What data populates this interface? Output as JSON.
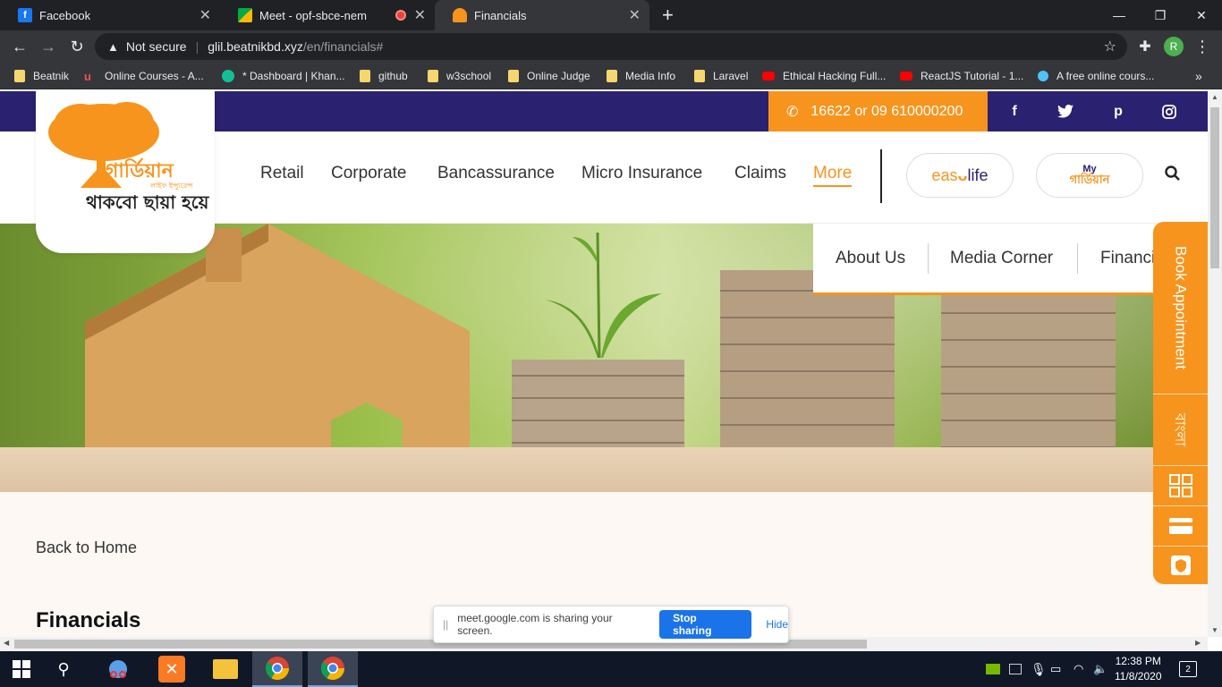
{
  "browser": {
    "tabs": [
      {
        "title": "Facebook",
        "favicon": "facebook-icon",
        "active": false
      },
      {
        "title": "Meet - opf-sbce-nem",
        "favicon": "google-meet-icon",
        "active": false,
        "recording": true
      },
      {
        "title": "Financials",
        "favicon": "guardian-umbrella-icon",
        "active": true
      }
    ],
    "new_tab_label": "+",
    "window_controls": {
      "minimize": "—",
      "restore": "❐",
      "close": "✕"
    },
    "security_label": "Not secure",
    "url_host": "glil.beatnikbd.xyz",
    "url_path": "/en/financials#",
    "profile_initial": "R",
    "bookmarks": [
      {
        "label": "Beatnik",
        "icon": "folder"
      },
      {
        "label": "Online Courses - A...",
        "icon": "udemy-icon"
      },
      {
        "label": "* Dashboard | Khan...",
        "icon": "khan-academy-icon"
      },
      {
        "label": "github",
        "icon": "folder"
      },
      {
        "label": "w3school",
        "icon": "folder"
      },
      {
        "label": "Online Judge",
        "icon": "folder"
      },
      {
        "label": "Media Info",
        "icon": "folder"
      },
      {
        "label": "Laravel",
        "icon": "folder"
      },
      {
        "label": "Ethical Hacking Full...",
        "icon": "youtube-icon"
      },
      {
        "label": "ReactJS Tutorial - 1...",
        "icon": "youtube-icon"
      },
      {
        "label": "A free online cours...",
        "icon": "site-icon"
      }
    ],
    "more_bookmarks": "»"
  },
  "site": {
    "phone": "16622 or 09 610000200",
    "social": [
      "f",
      "twitter-icon",
      "p",
      "instagram-icon"
    ],
    "nav": [
      {
        "label": "Retail",
        "active": false
      },
      {
        "label": "Corporate",
        "active": false
      },
      {
        "label": "Bancassurance",
        "active": false
      },
      {
        "label": "Micro Insurance",
        "active": false
      },
      {
        "label": "Claims",
        "active": false
      },
      {
        "label": "More",
        "active": true
      }
    ],
    "easylife_left": "eas",
    "easylife_right": "life",
    "my_guardian_top": "My",
    "my_guardian_bottom": "গার্ডিয়ান",
    "submenu": [
      "About Us",
      "Media Corner",
      "Financi"
    ],
    "back_link": "Back to Home",
    "page_title": "Financials",
    "side_tab": {
      "book": "Book Appointment",
      "bangla": "বাংলা"
    },
    "logo_text_top": "গার্ডিয়ান",
    "logo_text_sub": "লাইফ ইন্স্যুরেন্স",
    "logo_tagline": "থাকবো ছায়া হয়ে"
  },
  "share_bar": {
    "message": "meet.google.com is sharing your screen.",
    "stop": "Stop sharing",
    "hide": "Hide"
  },
  "taskbar": {
    "time": "12:38 PM",
    "date": "11/8/2020",
    "notification_count": "2"
  },
  "colors": {
    "brand_orange": "#f7941d",
    "brand_navy": "#2a2170",
    "chrome_dark": "#202124"
  }
}
